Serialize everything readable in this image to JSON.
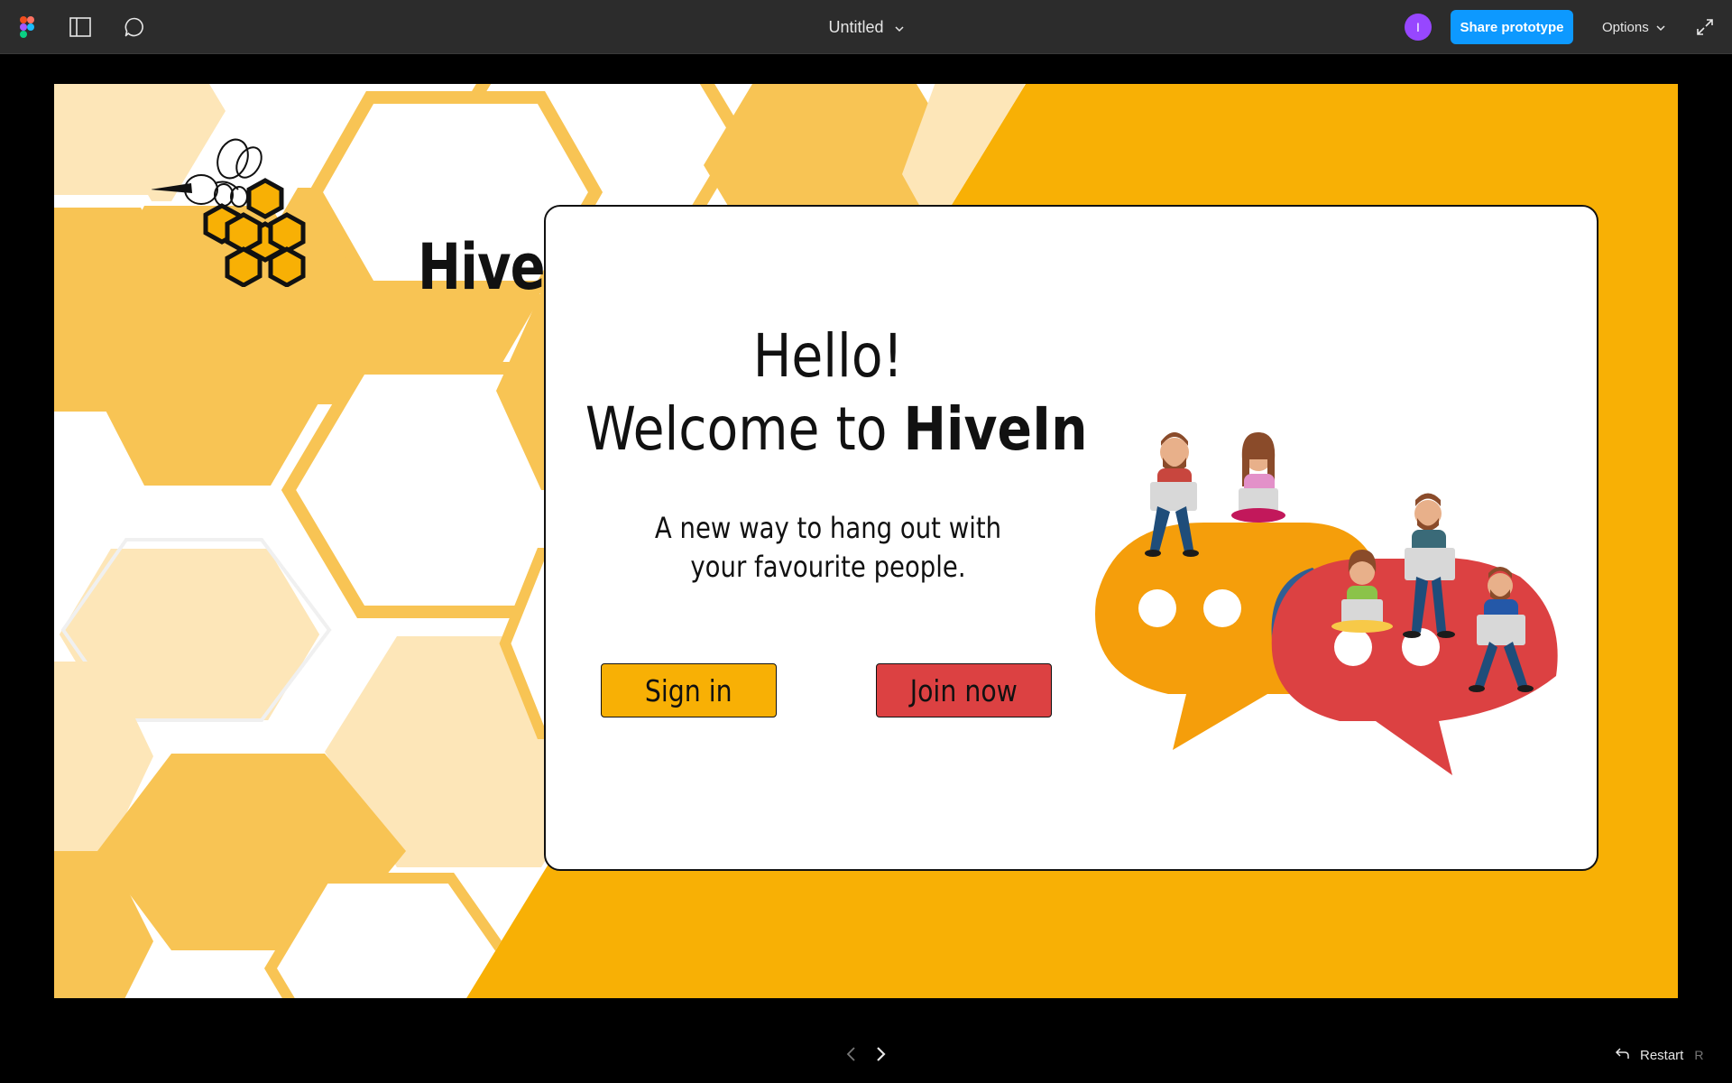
{
  "toolbar": {
    "file_title": "Untitled",
    "avatar_initial": "I",
    "share_label": "Share prototype",
    "options_label": "Options"
  },
  "frame": {
    "logo_text": "HiveIN",
    "hello": "Hello!",
    "welcome_prefix": "Welcome to",
    "welcome_brand": "HiveIn",
    "tagline_line1": "A new way to hang out with",
    "tagline_line2": "your favourite people.",
    "signin_label": "Sign in",
    "join_label": "Join now"
  },
  "footer": {
    "restart_label": "Restart",
    "restart_key": "R"
  },
  "colors": {
    "toolbar_bg": "#2c2c2c",
    "share_blue": "#0d99ff",
    "avatar_purple": "#9747ff",
    "honey_yellow": "#f8b005",
    "join_red": "#dc4142"
  },
  "icons": [
    "figma-logo-icon",
    "sidebar-panel-icon",
    "comment-icon",
    "chevron-down-icon",
    "expand-icon",
    "arrow-left-icon",
    "arrow-right-icon",
    "restart-icon"
  ]
}
